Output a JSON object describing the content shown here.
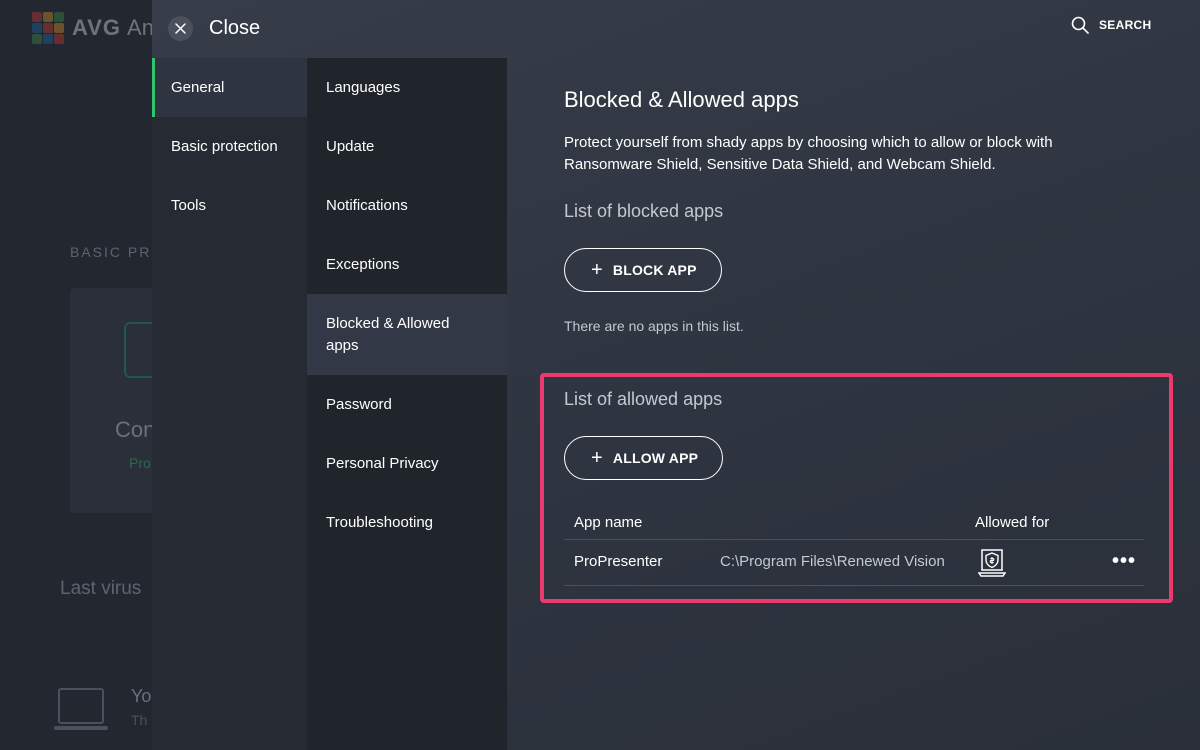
{
  "background": {
    "logo_text": "AVG",
    "logo_text_partial": "An",
    "section_label": "BASIC PR",
    "card_title": "Con",
    "card_status": "Pro",
    "last_virus": "Last virus",
    "bottom_title": "Yo",
    "bottom_subtitle": "Th"
  },
  "topbar": {
    "close_label": "Close",
    "search_label": "SEARCH"
  },
  "nav_primary": [
    {
      "label": "General",
      "active": true
    },
    {
      "label": "Basic protection",
      "active": false
    },
    {
      "label": "Tools",
      "active": false
    }
  ],
  "nav_secondary": [
    {
      "label": "Languages",
      "active": false
    },
    {
      "label": "Update",
      "active": false
    },
    {
      "label": "Notifications",
      "active": false
    },
    {
      "label": "Exceptions",
      "active": false
    },
    {
      "label": "Blocked & Allowed apps",
      "active": true
    },
    {
      "label": "Password",
      "active": false
    },
    {
      "label": "Personal Privacy",
      "active": false
    },
    {
      "label": "Troubleshooting",
      "active": false
    }
  ],
  "content": {
    "title": "Blocked & Allowed apps",
    "description": "Protect yourself from shady apps by choosing which to allow or block with Ransomware Shield, Sensitive Data Shield, and Webcam Shield.",
    "blocked_heading": "List of blocked apps",
    "block_button": "BLOCK APP",
    "blocked_empty": "There are no apps in this list.",
    "allowed_heading": "List of allowed apps",
    "allow_button": "ALLOW APP",
    "table": {
      "col_app_name": "App name",
      "col_allowed_for": "Allowed for",
      "rows": [
        {
          "name": "ProPresenter",
          "path": "C:\\Program Files\\Renewed Vision",
          "allowed_icon": "sensitive-data-shield-icon",
          "more": "•••"
        }
      ]
    }
  },
  "colors": {
    "accent_green": "#2fc46f",
    "highlight_border": "#ec3a6e"
  }
}
